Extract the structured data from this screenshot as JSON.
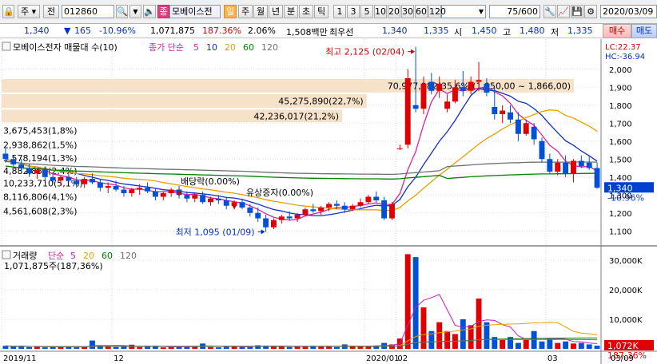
{
  "toolbar": {
    "market_select": "주",
    "period_btn": "전",
    "stock_code": "012860",
    "stock_name": "모베이스전",
    "tag": "일",
    "period_tabs": [
      "주",
      "월",
      "년",
      "분",
      "초",
      "틱"
    ],
    "interval_tabs": [
      "1",
      "3",
      "5",
      "10",
      "20",
      "30",
      "60",
      "120"
    ],
    "count": "75",
    "count_total": "/600",
    "date": "2020/03/09"
  },
  "info": {
    "price": "1,340",
    "change": "165",
    "change_pct": "-10.96%",
    "volume": "1,071,875",
    "volume_ratio": "187.36%",
    "turnover": "2.06%",
    "amount": "1,508백만",
    "best_ask_label": "최우선",
    "best_ask": "1,340",
    "best_bid": "1,335",
    "open_label": "시",
    "open": "1,450",
    "high_label": "고",
    "high": "1,480",
    "low_label": "저",
    "low": "1,335",
    "buy_label": "매수",
    "sell_label": "매도"
  },
  "price_panel": {
    "legend_title": "모베이스전자 매물대 수(10)",
    "ma_legend_prefix": "종가 단순",
    "ma_periods": [
      "5",
      "10",
      "20",
      "60",
      "120"
    ],
    "ma_colors": [
      "#e020a0",
      "#1030c0",
      "#e8a000",
      "#008000",
      "#707070"
    ],
    "lc_label": "LC:22.37",
    "hc_label": "HC:-36.94",
    "high_annotation": "최고 2,125 (02/04)",
    "low_annotation": "최저 1,095 (01/09)",
    "event_dividend": "배당락(0.00%)",
    "event_rights": "유상증자(0.00%)",
    "current_price_box": "1,340",
    "current_pct": "-10.96%",
    "volume_profile": [
      {
        "label": "70,977,982(35,6%)(1,950,00 ~ 1,866,00)",
        "amount": 70977982,
        "low": 1866,
        "high": 1950
      },
      {
        "label": "45,275,890(22,7%)",
        "amount": 45275890
      },
      {
        "label": "42,236,017(21,2%)",
        "amount": 42236017
      },
      {
        "label": "3,675,453(1,8%)",
        "amount": 3675453
      },
      {
        "label": "2,938,862(1,5%)",
        "amount": 2938862
      },
      {
        "label": "5,578,194(1,3%)",
        "amount": 5578194
      },
      {
        "label": "4,882,855(2,4%)",
        "amount": 4882855
      },
      {
        "label": "10,233,710(5,1%)",
        "amount": 10233710
      },
      {
        "label": "8,116,806(4,1%)",
        "amount": 8116806
      },
      {
        "label": "4,561,608(2,3%)",
        "amount": 4561608
      }
    ],
    "y_ticks": [
      "2,000",
      "1,900",
      "1,800",
      "1,700",
      "1,600",
      "1,500",
      "1,400",
      "1,300",
      "1,200",
      "1,100"
    ]
  },
  "volume_panel": {
    "legend_title": "거래량",
    "ma_legend_prefix": "단순",
    "ma_periods": [
      "5",
      "20",
      "60",
      "120"
    ],
    "current_volume_label": "1,071,875주(187,36%)",
    "y_ticks": [
      "30,000K",
      "20,000K",
      "10,000K"
    ],
    "current_box": "1,072K",
    "current_pct": "187.36%"
  },
  "x_axis": {
    "labels": [
      "2019/11",
      "12",
      "2020/01",
      "02",
      "03",
      "03/09"
    ]
  },
  "chart_data": {
    "type": "candlestick",
    "title": "모베이스전자",
    "ylim": [
      1030,
      2150
    ],
    "candles": [
      {
        "o": 1530,
        "h": 1560,
        "l": 1480,
        "c": 1500
      },
      {
        "o": 1500,
        "h": 1520,
        "l": 1460,
        "c": 1470
      },
      {
        "o": 1470,
        "h": 1500,
        "l": 1430,
        "c": 1450
      },
      {
        "o": 1450,
        "h": 1470,
        "l": 1400,
        "c": 1420
      },
      {
        "o": 1420,
        "h": 1450,
        "l": 1390,
        "c": 1440
      },
      {
        "o": 1440,
        "h": 1460,
        "l": 1380,
        "c": 1400
      },
      {
        "o": 1400,
        "h": 1420,
        "l": 1360,
        "c": 1380
      },
      {
        "o": 1380,
        "h": 1410,
        "l": 1350,
        "c": 1400
      },
      {
        "o": 1400,
        "h": 1430,
        "l": 1370,
        "c": 1380
      },
      {
        "o": 1380,
        "h": 1400,
        "l": 1340,
        "c": 1360
      },
      {
        "o": 1360,
        "h": 1400,
        "l": 1340,
        "c": 1390
      },
      {
        "o": 1390,
        "h": 1420,
        "l": 1360,
        "c": 1370
      },
      {
        "o": 1370,
        "h": 1390,
        "l": 1320,
        "c": 1340
      },
      {
        "o": 1340,
        "h": 1370,
        "l": 1310,
        "c": 1350
      },
      {
        "o": 1350,
        "h": 1380,
        "l": 1320,
        "c": 1330
      },
      {
        "o": 1330,
        "h": 1350,
        "l": 1290,
        "c": 1310
      },
      {
        "o": 1310,
        "h": 1340,
        "l": 1290,
        "c": 1330
      },
      {
        "o": 1330,
        "h": 1360,
        "l": 1300,
        "c": 1340
      },
      {
        "o": 1340,
        "h": 1370,
        "l": 1310,
        "c": 1320
      },
      {
        "o": 1320,
        "h": 1340,
        "l": 1270,
        "c": 1290
      },
      {
        "o": 1290,
        "h": 1320,
        "l": 1270,
        "c": 1310
      },
      {
        "o": 1310,
        "h": 1340,
        "l": 1290,
        "c": 1330
      },
      {
        "o": 1330,
        "h": 1350,
        "l": 1280,
        "c": 1300
      },
      {
        "o": 1300,
        "h": 1320,
        "l": 1260,
        "c": 1280
      },
      {
        "o": 1280,
        "h": 1310,
        "l": 1260,
        "c": 1300
      },
      {
        "o": 1300,
        "h": 1320,
        "l": 1250,
        "c": 1260
      },
      {
        "o": 1260,
        "h": 1290,
        "l": 1240,
        "c": 1280
      },
      {
        "o": 1280,
        "h": 1300,
        "l": 1250,
        "c": 1270
      },
      {
        "o": 1270,
        "h": 1290,
        "l": 1220,
        "c": 1240
      },
      {
        "o": 1240,
        "h": 1270,
        "l": 1220,
        "c": 1260
      },
      {
        "o": 1260,
        "h": 1280,
        "l": 1220,
        "c": 1230
      },
      {
        "o": 1230,
        "h": 1250,
        "l": 1180,
        "c": 1200
      },
      {
        "o": 1200,
        "h": 1230,
        "l": 1150,
        "c": 1170
      },
      {
        "o": 1170,
        "h": 1190,
        "l": 1095,
        "c": 1120
      },
      {
        "o": 1120,
        "h": 1170,
        "l": 1110,
        "c": 1160
      },
      {
        "o": 1160,
        "h": 1190,
        "l": 1140,
        "c": 1180
      },
      {
        "o": 1180,
        "h": 1210,
        "l": 1160,
        "c": 1170
      },
      {
        "o": 1170,
        "h": 1200,
        "l": 1150,
        "c": 1190
      },
      {
        "o": 1190,
        "h": 1230,
        "l": 1180,
        "c": 1220
      },
      {
        "o": 1220,
        "h": 1250,
        "l": 1200,
        "c": 1210
      },
      {
        "o": 1210,
        "h": 1240,
        "l": 1190,
        "c": 1230
      },
      {
        "o": 1230,
        "h": 1260,
        "l": 1210,
        "c": 1250
      },
      {
        "o": 1250,
        "h": 1270,
        "l": 1220,
        "c": 1240
      },
      {
        "o": 1240,
        "h": 1260,
        "l": 1200,
        "c": 1220
      },
      {
        "o": 1220,
        "h": 1250,
        "l": 1210,
        "c": 1240
      },
      {
        "o": 1240,
        "h": 1280,
        "l": 1230,
        "c": 1260
      },
      {
        "o": 1260,
        "h": 1300,
        "l": 1250,
        "c": 1290
      },
      {
        "o": 1290,
        "h": 1320,
        "l": 1260,
        "c": 1270
      },
      {
        "o": 1270,
        "h": 1290,
        "l": 1160,
        "c": 1170
      },
      {
        "o": 1170,
        "h": 1260,
        "l": 1160,
        "c": 1250
      },
      {
        "o": 1560,
        "h": 1580,
        "l": 1550,
        "c": 1560
      },
      {
        "o": 1580,
        "h": 2000,
        "l": 1560,
        "c": 1950
      },
      {
        "o": 1800,
        "h": 2125,
        "l": 1760,
        "c": 1780
      },
      {
        "o": 1780,
        "h": 1960,
        "l": 1750,
        "c": 1920
      },
      {
        "o": 1930,
        "h": 1980,
        "l": 1860,
        "c": 1880
      },
      {
        "o": 1880,
        "h": 1960,
        "l": 1840,
        "c": 1920
      },
      {
        "o": 1780,
        "h": 1860,
        "l": 1760,
        "c": 1820
      },
      {
        "o": 1820,
        "h": 1940,
        "l": 1810,
        "c": 1900
      },
      {
        "o": 1900,
        "h": 1990,
        "l": 1850,
        "c": 1880
      },
      {
        "o": 1880,
        "h": 1960,
        "l": 1860,
        "c": 1930
      },
      {
        "o": 1930,
        "h": 2040,
        "l": 1880,
        "c": 1940
      },
      {
        "o": 1920,
        "h": 1950,
        "l": 1850,
        "c": 1870
      },
      {
        "o": 1790,
        "h": 1900,
        "l": 1720,
        "c": 1750
      },
      {
        "o": 1750,
        "h": 1800,
        "l": 1700,
        "c": 1770
      },
      {
        "o": 1760,
        "h": 1800,
        "l": 1700,
        "c": 1720
      },
      {
        "o": 1720,
        "h": 1760,
        "l": 1600,
        "c": 1640
      },
      {
        "o": 1640,
        "h": 1720,
        "l": 1630,
        "c": 1700
      },
      {
        "o": 1680,
        "h": 1700,
        "l": 1580,
        "c": 1610
      },
      {
        "o": 1600,
        "h": 1620,
        "l": 1480,
        "c": 1500
      },
      {
        "o": 1500,
        "h": 1530,
        "l": 1420,
        "c": 1430
      },
      {
        "o": 1430,
        "h": 1500,
        "l": 1410,
        "c": 1480
      },
      {
        "o": 1480,
        "h": 1520,
        "l": 1400,
        "c": 1420
      },
      {
        "o": 1420,
        "h": 1500,
        "l": 1370,
        "c": 1490
      },
      {
        "o": 1490,
        "h": 1520,
        "l": 1450,
        "c": 1460
      },
      {
        "o": 1480,
        "h": 1520,
        "l": 1440,
        "c": 1450
      },
      {
        "o": 1450,
        "h": 1480,
        "l": 1335,
        "c": 1340
      }
    ],
    "volume_series": {
      "name": "거래량",
      "values": [
        1000,
        700,
        900,
        600,
        800,
        500,
        700,
        600,
        900,
        500,
        600,
        2800,
        900,
        700,
        600,
        800,
        1400,
        600,
        700,
        900,
        500,
        600,
        800,
        700,
        900,
        1800,
        600,
        500,
        700,
        900,
        600,
        800,
        1200,
        1100,
        900,
        700,
        600,
        800,
        900,
        1000,
        700,
        800,
        600,
        1500,
        900,
        700,
        800,
        1100,
        2000,
        1500,
        3500,
        32000,
        31000,
        14000,
        6000,
        9000,
        6000,
        5000,
        10000,
        8000,
        17000,
        9000,
        4000,
        3000,
        4000,
        2000,
        3000,
        6000,
        2500,
        3500,
        2000,
        2500,
        1800,
        2000,
        1500,
        1072
      ]
    },
    "volume_ylim": [
      0,
      34000
    ],
    "y_tick_values": [
      2000,
      1900,
      1800,
      1700,
      1600,
      1500,
      1400,
      1300,
      1200,
      1100
    ],
    "volume_tick_values": [
      30000,
      20000,
      10000
    ]
  }
}
